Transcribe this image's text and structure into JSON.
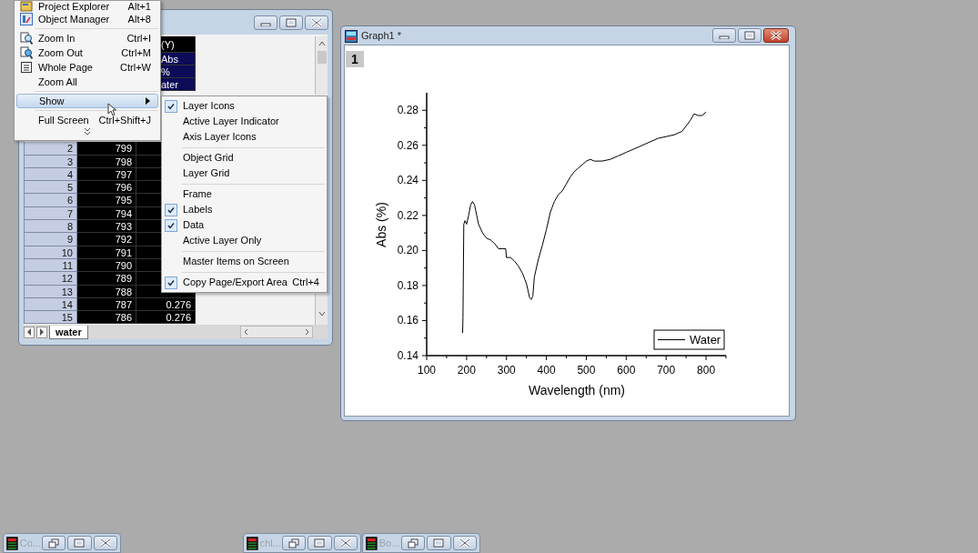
{
  "menu": {
    "items": [
      {
        "kind": "item",
        "label": "Project Explorer",
        "shortcut": "Alt+1",
        "highlighted": false
      },
      {
        "kind": "item",
        "label": "Object Manager",
        "shortcut": "Alt+8",
        "highlighted": false
      },
      {
        "kind": "separator"
      },
      {
        "kind": "item",
        "label": "Zoom In",
        "shortcut": "Ctrl+I",
        "highlighted": false
      },
      {
        "kind": "item",
        "label": "Zoom Out",
        "shortcut": "Ctrl+M",
        "highlighted": false
      },
      {
        "kind": "item",
        "label": "Whole Page",
        "shortcut": "Ctrl+W",
        "highlighted": false
      },
      {
        "kind": "item",
        "label": "Zoom All",
        "highlighted": false
      },
      {
        "kind": "separator"
      },
      {
        "kind": "submenu",
        "label": "Show",
        "highlighted": true
      },
      {
        "kind": "separator"
      },
      {
        "kind": "item",
        "label": "Full Screen",
        "shortcut": "Ctrl+Shift+J",
        "highlighted": false
      },
      {
        "kind": "expand"
      }
    ]
  },
  "submenu": {
    "items": [
      {
        "kind": "item",
        "label": "Layer Icons",
        "checked": true
      },
      {
        "kind": "item",
        "label": "Active Layer Indicator",
        "checked": false
      },
      {
        "kind": "item",
        "label": "Axis Layer Icons",
        "checked": false
      },
      {
        "kind": "separator"
      },
      {
        "kind": "item",
        "label": "Object Grid",
        "checked": false
      },
      {
        "kind": "item",
        "label": "Layer Grid",
        "checked": false
      },
      {
        "kind": "separator"
      },
      {
        "kind": "item",
        "label": "Frame",
        "checked": false
      },
      {
        "kind": "item",
        "label": "Labels",
        "checked": true
      },
      {
        "kind": "item",
        "label": "Data",
        "checked": true
      },
      {
        "kind": "item",
        "label": "Active Layer Only",
        "checked": false
      },
      {
        "kind": "separator"
      },
      {
        "kind": "item",
        "label": "Master Items on Screen",
        "checked": false
      },
      {
        "kind": "separator"
      },
      {
        "kind": "item",
        "label": "Copy Page/Export Area",
        "checked": true,
        "shortcut": "Ctrl+4"
      }
    ]
  },
  "worksheet": {
    "column_b_header": [
      "(Y)",
      "Abs",
      "%",
      "ater"
    ],
    "rows": [
      {
        "row": "2",
        "a": "799"
      },
      {
        "row": "3",
        "a": "798"
      },
      {
        "row": "4",
        "a": "797"
      },
      {
        "row": "5",
        "a": "796"
      },
      {
        "row": "6",
        "a": "795"
      },
      {
        "row": "7",
        "a": "794"
      },
      {
        "row": "8",
        "a": "793"
      },
      {
        "row": "9",
        "a": "792"
      },
      {
        "row": "10",
        "a": "791"
      },
      {
        "row": "11",
        "a": "790"
      },
      {
        "row": "12",
        "a": "789"
      },
      {
        "row": "13",
        "a": "788"
      },
      {
        "row": "14",
        "a": "787",
        "b": "0.276"
      },
      {
        "row": "15",
        "a": "786",
        "b": "0.276"
      }
    ],
    "sheet_tab": "water"
  },
  "graph_window": {
    "title": "Graph1 *",
    "layer": "1",
    "chart_data": {
      "type": "line",
      "xlabel": "Wavelength (nm)",
      "ylabel": "Abs (%)",
      "xlim": [
        100,
        850
      ],
      "ylim": [
        0.14,
        0.29
      ],
      "xticks": [
        100,
        200,
        300,
        400,
        500,
        600,
        700,
        800
      ],
      "yticks": [
        {
          "value": 0.14,
          "label": "0.14"
        },
        {
          "value": 0.16,
          "label": "0.16"
        },
        {
          "value": 0.18,
          "label": "0.18"
        },
        {
          "value": 0.2,
          "label": "0.20"
        },
        {
          "value": 0.22,
          "label": "0.22"
        },
        {
          "value": 0.24,
          "label": "0.24"
        },
        {
          "value": 0.26,
          "label": "0.26"
        },
        {
          "value": 0.28,
          "label": "0.28"
        }
      ],
      "x": [
        190,
        191,
        193,
        196,
        200,
        205,
        210,
        215,
        220,
        230,
        240,
        250,
        260,
        270,
        280,
        290,
        298,
        300,
        310,
        320,
        330,
        340,
        350,
        358,
        362,
        366,
        370,
        380,
        390,
        400,
        410,
        420,
        430,
        440,
        450,
        460,
        470,
        480,
        490,
        500,
        510,
        520,
        540,
        560,
        580,
        600,
        620,
        640,
        660,
        680,
        700,
        720,
        740,
        760,
        770,
        780,
        790,
        800
      ],
      "series": [
        {
          "name": "Water",
          "color": "#000000",
          "values": [
            0.153,
            0.162,
            0.215,
            0.217,
            0.215,
            0.22,
            0.226,
            0.228,
            0.226,
            0.215,
            0.21,
            0.207,
            0.206,
            0.204,
            0.201,
            0.201,
            0.201,
            0.196,
            0.196,
            0.194,
            0.191,
            0.187,
            0.181,
            0.173,
            0.172,
            0.174,
            0.185,
            0.195,
            0.203,
            0.212,
            0.222,
            0.228,
            0.232,
            0.234,
            0.238,
            0.242,
            0.245,
            0.247,
            0.249,
            0.251,
            0.252,
            0.251,
            0.251,
            0.252,
            0.254,
            0.256,
            0.258,
            0.26,
            0.262,
            0.264,
            0.265,
            0.266,
            0.268,
            0.274,
            0.278,
            0.277,
            0.277,
            0.279
          ]
        }
      ]
    }
  },
  "taskbar": [
    {
      "label": "Co..."
    },
    {
      "label": "chl..."
    },
    {
      "label": "Bo..."
    }
  ]
}
